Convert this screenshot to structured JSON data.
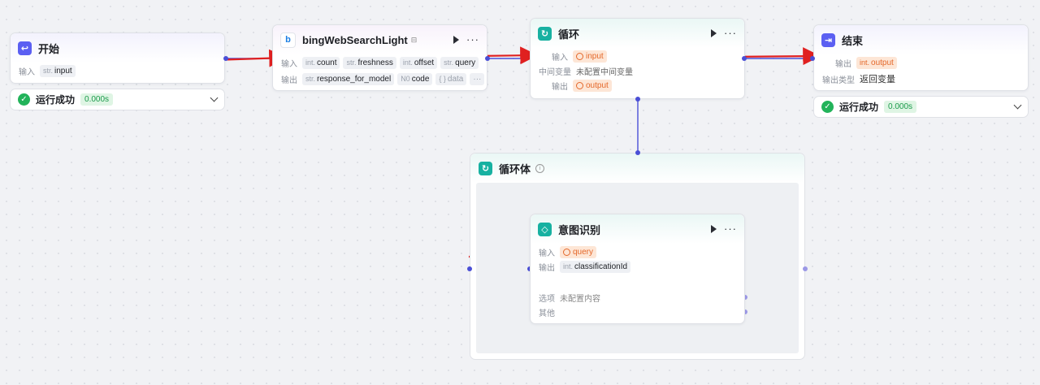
{
  "nodes": {
    "start": {
      "title": "开始",
      "input_label": "输入",
      "input_type": "str.",
      "input_name": "input"
    },
    "start_status": {
      "text": "运行成功",
      "time": "0.000s"
    },
    "bing": {
      "title": "bingWebSearchLight",
      "input_label": "输入",
      "inputs": [
        {
          "type": "int.",
          "name": "count"
        },
        {
          "type": "str.",
          "name": "freshness"
        },
        {
          "type": "int.",
          "name": "offset"
        },
        {
          "type": "str.",
          "name": "query"
        }
      ],
      "output_label": "输出",
      "outputs": [
        {
          "type": "str.",
          "name": "response_for_model"
        },
        {
          "type": "N0",
          "name": "code"
        },
        {
          "type": "{ }",
          "name": "data"
        }
      ],
      "more": "···"
    },
    "loop": {
      "title": "循环",
      "input_label": "输入",
      "input_name": "input",
      "mid_label": "中间变量",
      "mid_value": "未配置中间变量",
      "output_label": "输出",
      "output_name": "output"
    },
    "end": {
      "title": "结束",
      "output_label": "输出",
      "output_type": "int.",
      "output_name": "output",
      "type_label": "输出类型",
      "type_value": "返回变量"
    },
    "end_status": {
      "text": "运行成功",
      "time": "0.000s"
    },
    "loop_body": {
      "title": "循环体"
    },
    "intent": {
      "title": "意图识别",
      "input_label": "输入",
      "input_name": "query",
      "output_label": "输出",
      "output_type": "int.",
      "output_name": "classificationId",
      "option_label": "选项",
      "option_value": "未配置内容",
      "other_label": "其他"
    }
  },
  "icons": [
    "start-icon",
    "bing-icon",
    "loop-icon",
    "end-icon",
    "intent-icon",
    "play-icon",
    "more-icon",
    "check-icon",
    "chevron-down-icon",
    "info-icon"
  ],
  "colors": {
    "accent": "#5b5ff2",
    "teal": "#17b1a1",
    "success": "#22b35a",
    "wire": "#4a4fd6",
    "annotation_arrow": "#e02020",
    "var_tag": "#e4682a"
  }
}
